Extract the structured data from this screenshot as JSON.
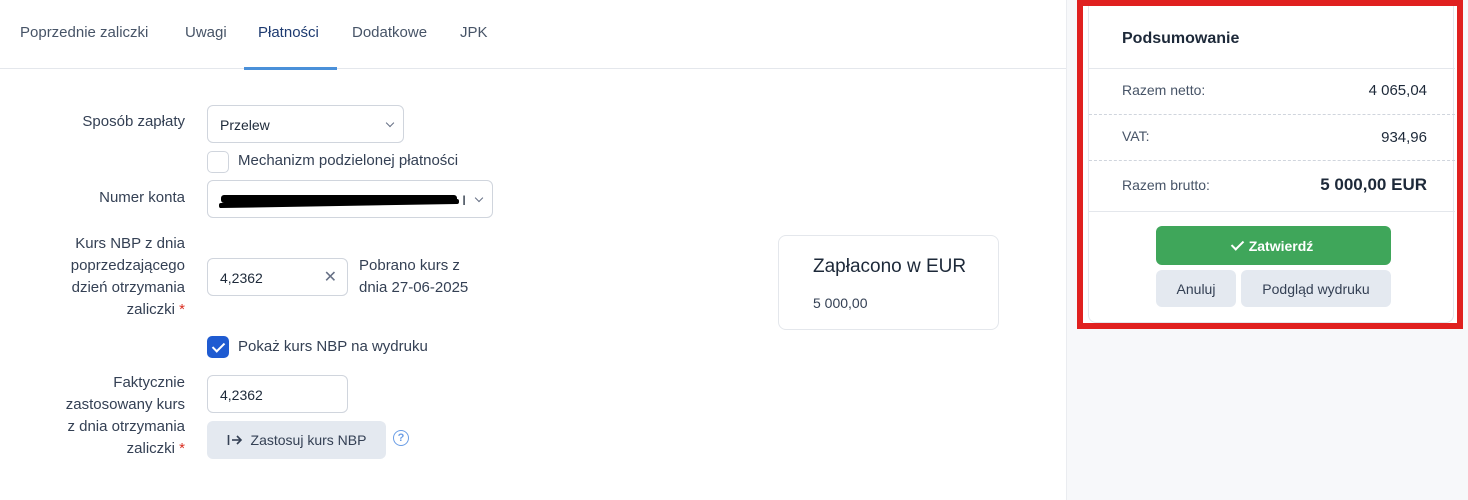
{
  "tabs": [
    {
      "label": "Poprzednie zaliczki"
    },
    {
      "label": "Uwagi"
    },
    {
      "label": "Płatności"
    },
    {
      "label": "Dodatkowe"
    },
    {
      "label": "JPK"
    }
  ],
  "payment": {
    "method_label": "Sposób zapłaty",
    "method_value": "Przelew",
    "split_payment_label": "Mechanizm podzielonej płatności",
    "account_label": "Numer konta",
    "account_value_trailing": "I",
    "nbp_rate_label_lines": [
      "Kurs NBP z dnia",
      "poprzedzającego",
      "dzień otrzymania",
      "zaliczki"
    ],
    "nbp_rate_value": "4,2362",
    "fetched_info_lines": [
      "Pobrano kurs z",
      "dnia 27-06-2025"
    ],
    "show_nbp_label": "Pokaż kurs NBP na wydruku",
    "actual_rate_label_lines": [
      "Faktycznie",
      "zastosowany kurs",
      "z dnia otrzymania",
      "zaliczki"
    ],
    "actual_rate_value": "4,2362",
    "apply_nbp_label": "Zastosuj kurs NBP",
    "required_mark": "*",
    "help_mark": "?"
  },
  "paid": {
    "title": "Zapłacono w EUR",
    "value": "5 000,00"
  },
  "summary": {
    "title": "Podsumowanie",
    "net_label": "Razem netto:",
    "net_value": "4 065,04",
    "vat_label": "VAT:",
    "vat_value": "934,96",
    "gross_label": "Razem brutto:",
    "gross_value": "5 000,00 EUR",
    "confirm_label": "Zatwierdź",
    "cancel_label": "Anuluj",
    "preview_label": "Podgląd wydruku"
  },
  "colors": {
    "accent": "#4a90d9",
    "confirm": "#3fa65a",
    "highlight_border": "#e0201f",
    "checkbox_checked": "#1f5bd1"
  }
}
